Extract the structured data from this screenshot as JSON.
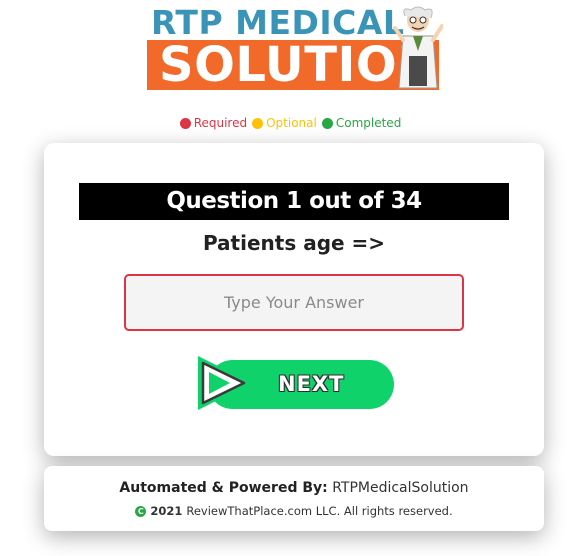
{
  "logo": {
    "line1": "RTP MEDICAL",
    "line2": "SOLUTION",
    "colors": {
      "top_text": "#3a94b8",
      "banner": "#f26a2a"
    }
  },
  "legend": [
    {
      "label": "Required",
      "color": "#dc3545"
    },
    {
      "label": "Optional",
      "color": "#ffc107"
    },
    {
      "label": "Completed",
      "color": "#28a745"
    }
  ],
  "question": {
    "header": "Question 1 out of 34",
    "text": "Patients age =>",
    "answer_placeholder": "Type Your Answer",
    "answer_value": "",
    "next_label": "NEXT",
    "next_color": "#0fd36a"
  },
  "footer": {
    "powered_prefix": "Automated & Powered By:",
    "powered_name": "RTPMedicalSolution",
    "copyright_icon": "copyright-icon",
    "copyright_symbol": "C",
    "year": "2021",
    "rights": "ReviewThatPlace.com LLC. All rights reserved."
  }
}
